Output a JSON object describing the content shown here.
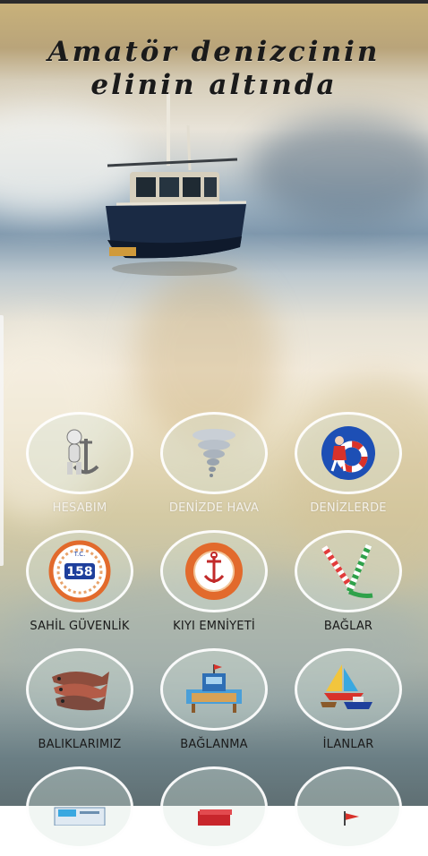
{
  "header": {
    "line1": "Amatör denizcinin",
    "line2": "elinin altında"
  },
  "menu": [
    {
      "label": "HESABIM",
      "icon": "anchor-figure-icon"
    },
    {
      "label": "DENİZDE HAVA",
      "icon": "tornado-icon"
    },
    {
      "label": "DENİZLERDE",
      "icon": "lifebuoy-icon"
    },
    {
      "label": "SAHİL GÜVENLİK",
      "icon": "coast-guard-158-icon",
      "badge": "158",
      "badge_top": "T.C."
    },
    {
      "label": "KIYI EMNİYETİ",
      "icon": "coastal-safety-emblem-icon"
    },
    {
      "label": "BAĞLAR",
      "icon": "rope-knot-icon"
    },
    {
      "label": "BALIKLARIMIZ",
      "icon": "fish-icon"
    },
    {
      "label": "BAĞLANMA",
      "icon": "pier-mooring-icon"
    },
    {
      "label": "İLANLAR",
      "icon": "sailboat-ads-icon"
    }
  ],
  "colors": {
    "buoy_blue": "#1d4fb5",
    "buoy_red": "#d8322a",
    "label_dark": "#1a1a1a",
    "label_light": "#f4f1ea",
    "circle_border": "#ffffff"
  }
}
